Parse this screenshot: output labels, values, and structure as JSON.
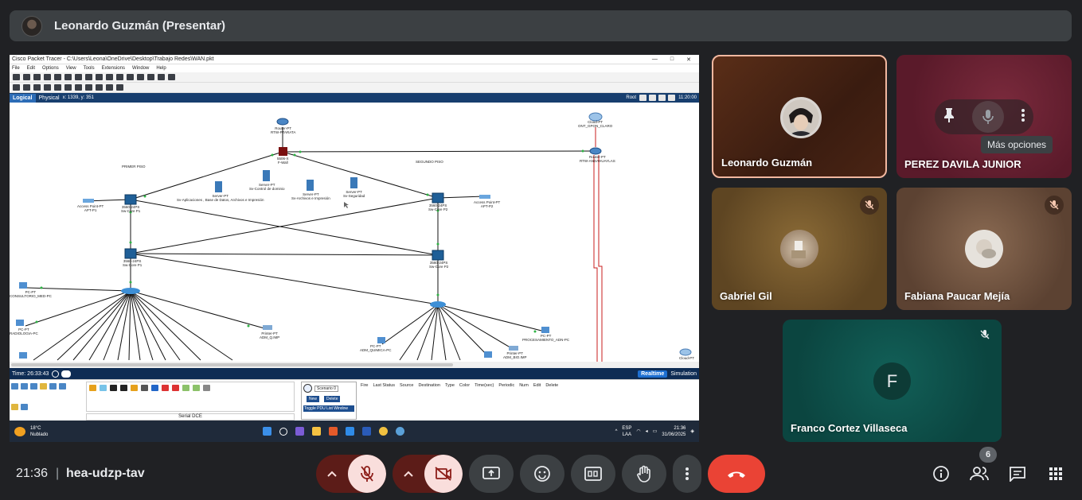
{
  "presenter": {
    "name": "Leonardo Guzmán (Presentar)"
  },
  "packet_tracer": {
    "title": "Cisco Packet Tracer - C:\\Users\\Leona\\OneDrive\\Desktop\\Trabajo Redes\\WAN.pkt",
    "menu": [
      "File",
      "Edit",
      "Options",
      "View",
      "Tools",
      "Extensions",
      "Window",
      "Help"
    ],
    "modes": {
      "logical": "Logical",
      "physical": "Physical",
      "coords": "x: 1339, y: 351",
      "root": "Root",
      "clock": "11:20:00"
    },
    "areas": {
      "first_floor": "PRIMER PISO",
      "second_floor": "SEGUNDO PISO"
    },
    "devices": {
      "router1": "Router-PT\nRTW-PTARATA",
      "router2": "Router-PT\nRTW-ANDAHUAYLAS",
      "cloud": "Cloud-PT\nONT_GPON_CLARO",
      "firewall": "5506-X\nF-Wall",
      "ap1": "Access Point-PT\nAPT-P1",
      "ap2": "Access Point-PT\nAPT-P2",
      "core1": "3560-24PS\nSw-Core P1",
      "core2": "3560-24PS\nSw-Core P2",
      "sw1": "3560-24PS\nSw-Core P1",
      "sw2": "3560-24PS\nSw-Core P2",
      "srv1": "Server-PT\nSv-Aplicaciones , Base de Datos, Archivos e Impresión",
      "srv2": "Server-PT\nSv-Control de dominio",
      "srv3": "Server-PT\nSv-Archivos e Impresión",
      "srv4": "Server-PT\nSv-Seguridad",
      "pc1": "PC-PT\nCONSULTORIO_MED-PC",
      "pc2": "PC-PT\nRADIOLOGIA-PC",
      "printer1": "Printer-PT\nADM_Q.IMP",
      "pc3": "PC-PT\nADM_QUIMICA-PC",
      "pc4": "PC-PT\nPROCESAMIENTO_ADN-PC",
      "printer2": "Printer-PT\nADM_BIO.IMP",
      "cloud2": "Cloud-PT"
    },
    "time": "Time: 26:33:43",
    "realtime": "Realtime",
    "simulation": "Simulation",
    "serial_dce": "Serial DCE",
    "scenario": "Scenario 0",
    "new_btn": "New",
    "delete_btn": "Delete",
    "toggle_pdu": "Toggle PDU List Window",
    "pdu_columns": [
      "Fire",
      "Last Status",
      "Source",
      "Destination",
      "Type",
      "Color",
      "Time(sec)",
      "Periodic",
      "Num",
      "Edit",
      "Delete"
    ]
  },
  "taskbar": {
    "weather_temp": "18°C",
    "weather_desc": "Nublado",
    "lang": "ESP",
    "lang2": "LAA",
    "time": "21:36",
    "date": "31/06/2025"
  },
  "participants": [
    {
      "name": "Leonardo Guzmán"
    },
    {
      "name": "PEREZ DAVILA JUNIOR",
      "tooltip": "Más opciones"
    },
    {
      "name": "Gabriel Gil"
    },
    {
      "name": "Fabiana Paucar Mejía"
    },
    {
      "name": "Franco Cortez Villaseca",
      "initial": "F"
    }
  ],
  "footer": {
    "clock": "21:36",
    "separator": "|",
    "meeting_code": "hea-udzp-tav",
    "people_count": "6"
  },
  "colors": {
    "background": "#202124",
    "end_call": "#ea4335",
    "muted_red": "#f9dedc",
    "speaking_border": "#f2b8a0",
    "teal_tile": "#0b4a45"
  }
}
